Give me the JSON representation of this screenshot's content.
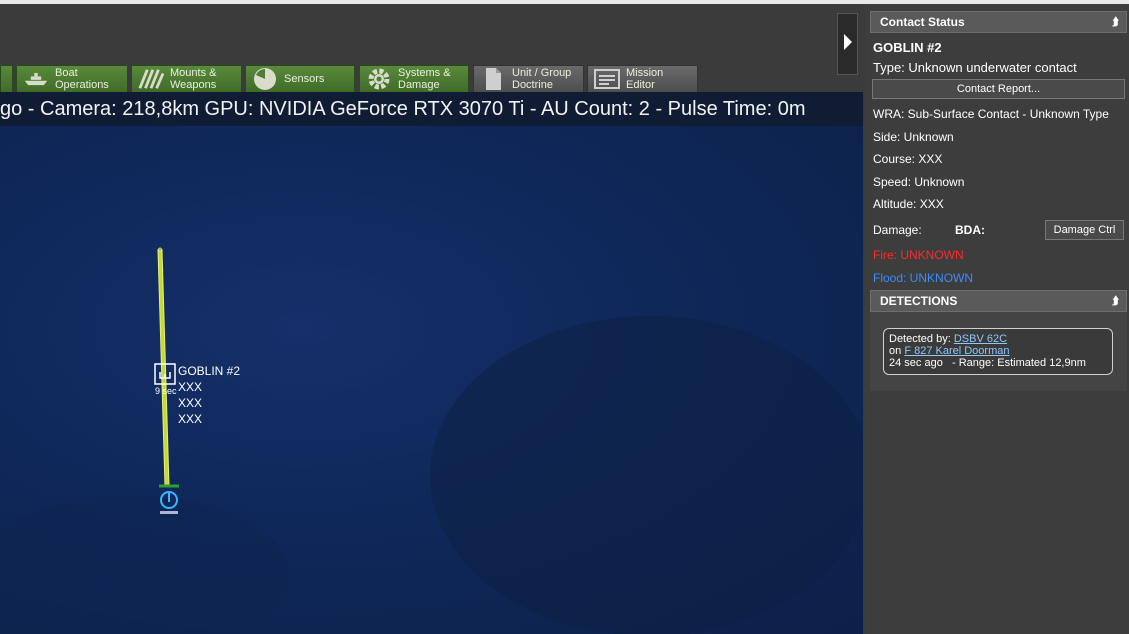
{
  "toolbar": {
    "buttons": [
      {
        "label": "Boat\nOperations",
        "icon": "boat-icon"
      },
      {
        "label": "Mounts &\nWeapons",
        "icon": "weapons-icon"
      },
      {
        "label": "Sensors",
        "icon": "sensors-icon"
      },
      {
        "label": "Systems &\nDamage",
        "icon": "gear-icon"
      },
      {
        "label": "Unit / Group\nDoctrine",
        "icon": "doctrine-icon"
      },
      {
        "label": "Mission\nEditor",
        "icon": "mission-editor-icon"
      }
    ]
  },
  "infobar": {
    "text": "go - Camera: 218,8km GPU: NVIDIA GeForce RTX 3070 Ti - AU Count: 2 - Pulse Time: 0m"
  },
  "map": {
    "contact_label": "GOBLIN #2",
    "contact_lines": [
      "XXX",
      "XXX",
      "XXX"
    ],
    "contact_age": "9 sec"
  },
  "panel": {
    "contact_status_title": "Contact Status",
    "contact_name": "GOBLIN #2",
    "type_line": "Type: Unknown underwater contact",
    "contact_report_button": "Contact Report...",
    "wra": "WRA: Sub-Surface Contact - Unknown Type",
    "side": "Side: Unknown",
    "course": "Course: XXX",
    "speed": "Speed: Unknown",
    "altitude": "Altitude: XXX",
    "damage_label": "Damage:",
    "bda_label": "BDA:",
    "damage_ctrl_button": "Damage Ctrl",
    "fire": "Fire: UNKNOWN",
    "flood": "Flood: UNKNOWN",
    "detections_title": "DETECTIONS",
    "detection": {
      "detected_by_prefix": "Detected by:",
      "detected_by": "DSBV 62C",
      "on_prefix": "on",
      "on_unit": "F 827 Karel Doorman",
      "time_range": "24 sec ago   - Range: Estimated 12,9nm"
    }
  },
  "colors": {
    "ocean": "#0f285a",
    "toolbar_green": "#4f7d33",
    "fire_text": "#ff2a2a",
    "flood_text": "#3a8cff",
    "track_line": "#c8d832"
  }
}
